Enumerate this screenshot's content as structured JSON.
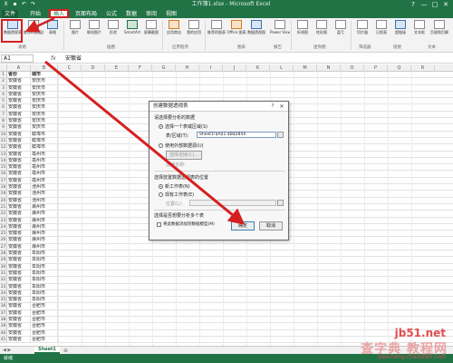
{
  "window": {
    "title": "工作簿1.xlsx - Microsoft Excel",
    "controls": [
      "?",
      "—",
      "□",
      "✕"
    ]
  },
  "tabs": [
    "文件",
    "开始",
    "插入",
    "页面布局",
    "公式",
    "数据",
    "审阅",
    "视图"
  ],
  "active_tab": "插入",
  "ribbon": {
    "buttons": [
      "数据透视表",
      "推荐的数据透视表",
      "表格",
      "图片",
      "联机图片",
      "形状",
      "SmartArt",
      "屏幕截图",
      "应用商店",
      "我的应用",
      "推荐的图表",
      "Office 图表",
      "数据透视图",
      "Power View",
      "折线图",
      "柱形图",
      "盈亏",
      "切片器",
      "日程表",
      "超链接",
      "文本框",
      "页眉和页脚",
      "艺术字",
      "签名行",
      "对象",
      "公式",
      "符号"
    ],
    "groups": [
      "表格",
      "插图",
      "应用程序",
      "图表",
      "报告",
      "迷你图",
      "筛选器",
      "链接",
      "文本",
      "符号"
    ]
  },
  "formula_bar": {
    "name_box": "A1",
    "fx": "fx",
    "value": "安徽省"
  },
  "columns": [
    "A",
    "B",
    "C",
    "D",
    "E",
    "F",
    "G",
    "H",
    "I",
    "J",
    "K",
    "L",
    "M",
    "N",
    "O",
    "P",
    "Q",
    "R"
  ],
  "sheet_header": [
    "省份",
    "城市"
  ],
  "sheet_rows": [
    [
      "安徽省",
      "安庆市"
    ],
    [
      "安徽省",
      "安庆市"
    ],
    [
      "安徽省",
      "安庆市"
    ],
    [
      "安徽省",
      "安庆市"
    ],
    [
      "安徽省",
      "安庆市"
    ],
    [
      "安徽省",
      "安庆市"
    ],
    [
      "安徽省",
      "安庆市"
    ],
    [
      "安徽省",
      "安庆市"
    ],
    [
      "安徽省",
      "蚌埠市"
    ],
    [
      "安徽省",
      "蚌埠市"
    ],
    [
      "安徽省",
      "蚌埠市"
    ],
    [
      "安徽省",
      "亳州市"
    ],
    [
      "安徽省",
      "亳州市"
    ],
    [
      "安徽省",
      "亳州市"
    ],
    [
      "安徽省",
      "亳州市"
    ],
    [
      "安徽省",
      "亳州市"
    ],
    [
      "安徽省",
      "池州市"
    ],
    [
      "安徽省",
      "池州市"
    ],
    [
      "安徽省",
      "池州市"
    ],
    [
      "安徽省",
      "滁州市"
    ],
    [
      "安徽省",
      "滁州市"
    ],
    [
      "安徽省",
      "滁州市"
    ],
    [
      "安徽省",
      "滁州市"
    ],
    [
      "安徽省",
      "滁州市"
    ],
    [
      "安徽省",
      "滁州市"
    ],
    [
      "安徽省",
      "滁州市"
    ],
    [
      "安徽省",
      "阜阳市"
    ],
    [
      "安徽省",
      "阜阳市"
    ],
    [
      "安徽省",
      "阜阳市"
    ],
    [
      "安徽省",
      "阜阳市"
    ],
    [
      "安徽省",
      "阜阳市"
    ],
    [
      "安徽省",
      "阜阳市"
    ],
    [
      "安徽省",
      "阜阳市"
    ],
    [
      "安徽省",
      "阜阳市"
    ],
    [
      "安徽省",
      "合肥市"
    ],
    [
      "安徽省",
      "合肥市"
    ],
    [
      "安徽省",
      "合肥市"
    ],
    [
      "安徽省",
      "合肥市"
    ],
    [
      "安徽省",
      "合肥市"
    ],
    [
      "安徽省",
      "合肥市"
    ]
  ],
  "dialog": {
    "title": "创建数据透视表",
    "help": "?",
    "close": "✕",
    "section1": "请选择要分析的数据",
    "radio1": "选择一个表或区域(S)",
    "range_label": "表/区域(T):",
    "range_value": "Sheet1!$A$1:$B$2844",
    "radio2": "使用外部数据源(U)",
    "choose_conn": "选择连接(C)...",
    "conn_name": "连接名称:",
    "section2": "选择放置数据透视表的位置",
    "radio3": "新工作表(N)",
    "radio4": "现有工作表(E)",
    "location_label": "位置(L):",
    "section3": "选择是否想要分析多个表",
    "checkbox": "将此数据添加到数据模型(M)",
    "ok": "确定",
    "cancel": "取消"
  },
  "sheet_tab": "Sheet1",
  "status": "就绪",
  "watermark": {
    "line1": "jb51.net",
    "line2": "查字典 教程网",
    "line3": "jiaocheng.chazidian.com"
  },
  "colors": {
    "excel_green": "#217346",
    "highlight_red": "#d61f1f"
  }
}
